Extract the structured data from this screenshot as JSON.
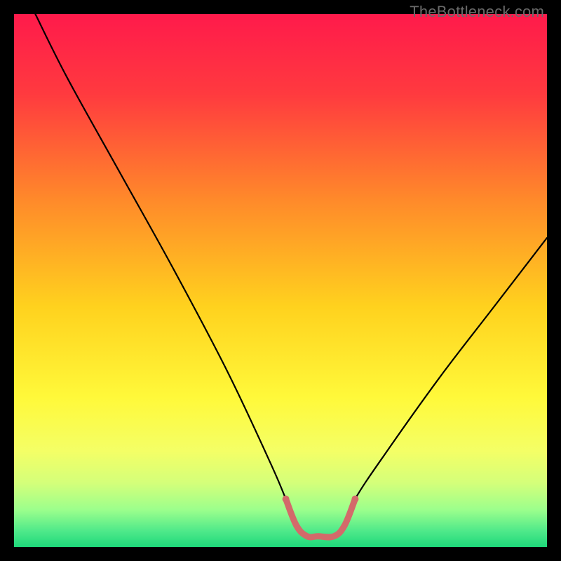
{
  "watermark": {
    "text": "TheBottleneck.com"
  },
  "chart_data": {
    "type": "line",
    "title": "",
    "xlabel": "",
    "ylabel": "",
    "xlim": [
      0,
      100
    ],
    "ylim": [
      0,
      100
    ],
    "series": [
      {
        "name": "bottleneck-curve",
        "x": [
          4,
          10,
          20,
          30,
          40,
          48,
          51,
          53,
          55,
          57,
          60,
          62,
          64,
          70,
          80,
          90,
          100
        ],
        "values": [
          100,
          88,
          70,
          52,
          33,
          16,
          9,
          4,
          2,
          2,
          2,
          4,
          9,
          18,
          32,
          45,
          58
        ]
      }
    ],
    "annotations": [
      {
        "name": "optimal-range-highlight",
        "x_start": 51,
        "x_end": 64,
        "color": "#d36a6a"
      }
    ],
    "background_gradient": [
      {
        "stop": 0.0,
        "color": "#ff1a4b"
      },
      {
        "stop": 0.15,
        "color": "#ff3a3f"
      },
      {
        "stop": 0.35,
        "color": "#ff8a2a"
      },
      {
        "stop": 0.55,
        "color": "#ffd21e"
      },
      {
        "stop": 0.72,
        "color": "#fff93a"
      },
      {
        "stop": 0.82,
        "color": "#f4ff66"
      },
      {
        "stop": 0.88,
        "color": "#d4ff7a"
      },
      {
        "stop": 0.93,
        "color": "#9cff8c"
      },
      {
        "stop": 0.97,
        "color": "#4fe98a"
      },
      {
        "stop": 1.0,
        "color": "#1ed87a"
      }
    ]
  }
}
